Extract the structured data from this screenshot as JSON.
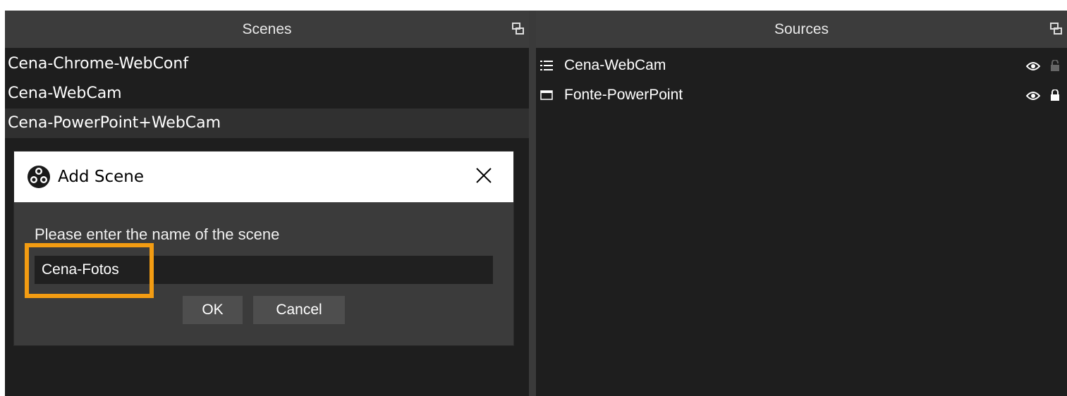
{
  "scenes": {
    "title": "Scenes",
    "items": [
      "Cena-Chrome-WebConf",
      "Cena-WebCam",
      "Cena-PowerPoint+WebCam"
    ]
  },
  "sources": {
    "title": "Sources",
    "items": [
      {
        "label": "Cena-WebCam",
        "type_icon": "scene-list-icon",
        "locked": false
      },
      {
        "label": "Fonte-PowerPoint",
        "type_icon": "window-capture-icon",
        "locked": true
      }
    ]
  },
  "dialog": {
    "title": "Add Scene",
    "prompt": "Please enter the name of the scene",
    "input_value": "Cena-Fotos",
    "ok_label": "OK",
    "cancel_label": "Cancel"
  },
  "colors": {
    "highlight": "#f39c12",
    "panel_bg": "#1e1e1e",
    "header_bg": "#3c3c3c"
  }
}
